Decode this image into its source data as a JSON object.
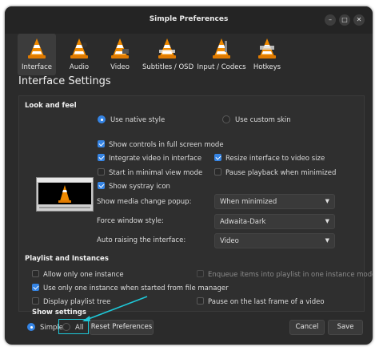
{
  "window": {
    "title": "Simple Preferences",
    "controls": {
      "minimize": "–",
      "maximize": "□",
      "close": "✕"
    }
  },
  "toolbar": {
    "items": [
      {
        "label": "Interface",
        "icon": "vlc-cone-interface-icon",
        "active": true
      },
      {
        "label": "Audio",
        "icon": "vlc-cone-audio-icon",
        "active": false
      },
      {
        "label": "Video",
        "icon": "vlc-cone-video-icon",
        "active": false
      },
      {
        "label": "Subtitles / OSD",
        "icon": "vlc-cone-subtitles-icon",
        "active": false
      },
      {
        "label": "Input / Codecs",
        "icon": "vlc-cone-input-icon",
        "active": false
      },
      {
        "label": "Hotkeys",
        "icon": "vlc-cone-hotkeys-icon",
        "active": false
      }
    ]
  },
  "page_title": "Interface Settings",
  "look_and_feel": {
    "heading": "Look and feel",
    "native_style": "Use native style",
    "custom_skin": "Use custom skin",
    "options": {
      "fullscreen_controls": "Show controls in full screen mode",
      "integrate_video": "Integrate video in interface",
      "resize_interface": "Resize interface to video size",
      "minimal_view": "Start in minimal view mode",
      "pause_minimized": "Pause playback when minimized",
      "systray": "Show systray icon"
    },
    "media_change_popup": {
      "label": "Show media change popup:",
      "value": "When minimized"
    },
    "force_window_style": {
      "label": "Force window style:",
      "value": "Adwaita-Dark"
    },
    "auto_raise": {
      "label": "Auto raising the interface:",
      "value": "Video"
    }
  },
  "playlist": {
    "heading": "Playlist and Instances",
    "one_instance": "Allow only one instance",
    "enqueue": "Enqueue items into playlist in one instance mode",
    "file_manager": "Use only one instance when started from file manager",
    "playlist_tree": "Display playlist tree",
    "pause_last_frame": "Pause on the last frame of a video"
  },
  "show_settings": {
    "heading": "Show settings",
    "simple": "Simple",
    "all": "All"
  },
  "buttons": {
    "reset": "Reset Preferences",
    "cancel": "Cancel",
    "save": "Save"
  },
  "colors": {
    "accent": "#3584e4",
    "annotation": "#1ec8d8",
    "window_bg": "#2b2b2b"
  }
}
